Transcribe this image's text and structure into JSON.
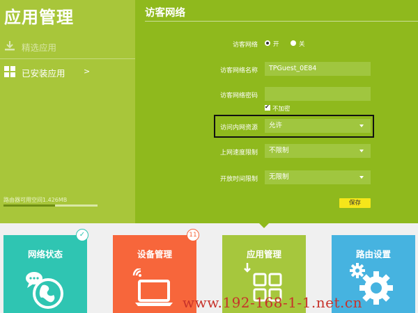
{
  "sidebar": {
    "app_title": "应用管理",
    "items": [
      {
        "label": "精选应用",
        "icon": "download-icon"
      },
      {
        "label": "已安装应用",
        "icon": "grid-icon",
        "chevron": ">"
      }
    ],
    "storage_text": "路由器可用空间1.426MB",
    "storage_fill": 0.55
  },
  "main": {
    "title": "访客网络",
    "fields": {
      "guest_network": {
        "label": "访客网络",
        "on_label": "开",
        "off_label": "关",
        "selected": "开"
      },
      "ssid": {
        "label": "访客网络名称",
        "value": "TPGuest_0E84"
      },
      "password": {
        "label": "访客网络密码",
        "value": "",
        "no_encrypt_label": "不加密",
        "no_encrypt_checked": true
      },
      "lan_access": {
        "label": "访问内网资源",
        "value": "允许"
      },
      "speed_limit": {
        "label": "上网速度限制",
        "value": "不限制"
      },
      "open_time": {
        "label": "开放时间限制",
        "value": "无限制"
      }
    },
    "save_label": "保存"
  },
  "tiles": [
    {
      "label": "网络状态",
      "badge": "✓",
      "icon": "globe-chat-icon",
      "color": "#2fc5b2"
    },
    {
      "label": "设备管理",
      "badge": "11",
      "icon": "laptop-wifi-icon",
      "color": "#f7663b"
    },
    {
      "label": "应用管理",
      "icon": "apps-grid-icon",
      "color": "#a6c73d"
    },
    {
      "label": "路由设置",
      "icon": "gears-icon",
      "color": "#46b3e0"
    }
  ],
  "watermark": "www.192-168-1-1.net.cn",
  "colors": {
    "sidebar": "#a8c63a",
    "main": "#8fb91d",
    "save": "#f5e61a",
    "highlight_border": "#111111"
  }
}
